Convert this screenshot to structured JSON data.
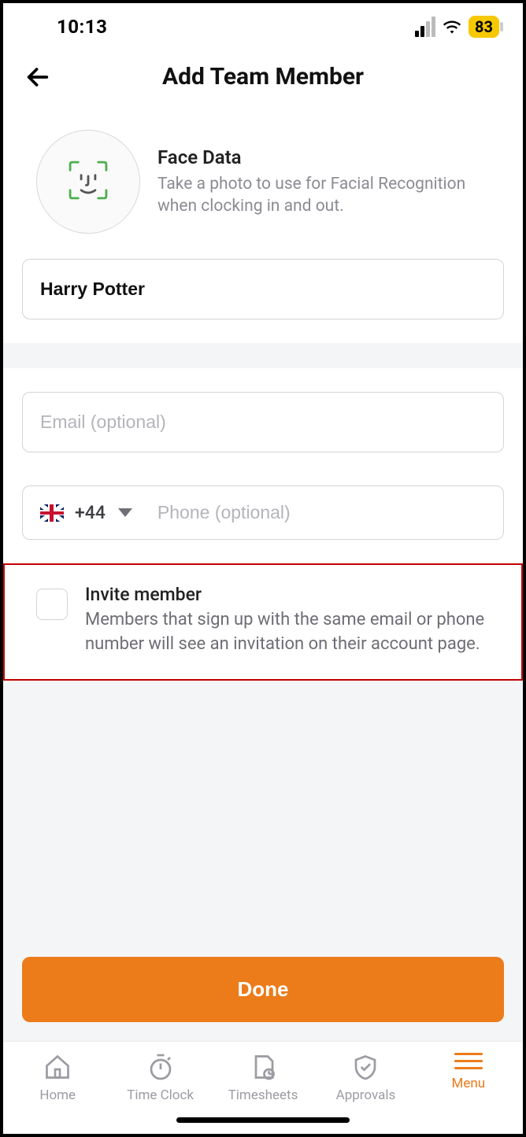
{
  "status": {
    "time": "10:13",
    "battery": "83"
  },
  "header": {
    "title": "Add Team Member"
  },
  "face": {
    "title": "Face Data",
    "desc": "Take a photo to use for Facial Recognition when clocking in and out."
  },
  "form": {
    "name_value": "Harry Potter",
    "email_placeholder": "Email (optional)",
    "country_code": "+44",
    "phone_placeholder": "Phone (optional)"
  },
  "invite": {
    "title": "Invite member",
    "desc": "Members that sign up with the same email or phone number will see an invitation on their account page."
  },
  "actions": {
    "done": "Done"
  },
  "tabs": {
    "home": "Home",
    "timeclock": "Time Clock",
    "timesheets": "Timesheets",
    "approvals": "Approvals",
    "menu": "Menu"
  }
}
